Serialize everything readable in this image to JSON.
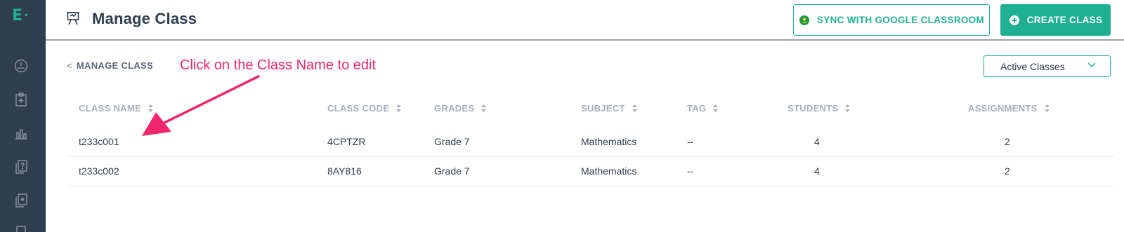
{
  "sidebar": {
    "logo": "E",
    "icons": [
      "dashboard-icon",
      "clipboard-add-icon",
      "bar-chart-icon",
      "question-bank-icon",
      "item-bank-icon",
      "more-icon"
    ]
  },
  "header": {
    "title": "Manage Class",
    "icon": "presentation-board-icon",
    "sync_button": "SYNC WITH GOOGLE CLASSROOM",
    "create_button": "CREATE CLASS"
  },
  "breadcrumb": {
    "symbol": "<",
    "label": "MANAGE CLASS"
  },
  "annotation": "Click on the Class Name to edit",
  "filter": {
    "selected": "Active Classes"
  },
  "table": {
    "columns": [
      "CLASS NAME",
      "CLASS CODE",
      "GRADES",
      "SUBJECT",
      "TAG",
      "STUDENTS",
      "ASSIGNMENTS"
    ],
    "rows": [
      [
        "t233c001",
        "4CPTZR",
        "Grade 7",
        "Mathematics",
        "--",
        "4",
        "2"
      ],
      [
        "t233c002",
        "8AY816",
        "Grade 7",
        "Mathematics",
        "--",
        "4",
        "2"
      ]
    ]
  },
  "colors": {
    "accent": "#1fb094",
    "sidebar": "#2f3e4e",
    "annotation": "#f0276d"
  }
}
